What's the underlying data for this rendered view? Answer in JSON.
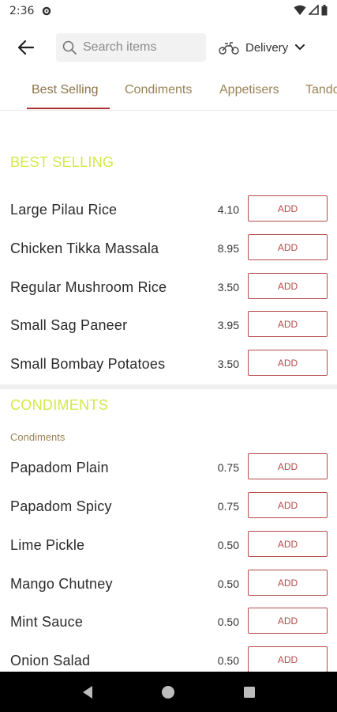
{
  "status": {
    "time": "2:36"
  },
  "search": {
    "placeholder": "Search items"
  },
  "delivery": {
    "label": "Delivery"
  },
  "tabs": [
    {
      "label": "Best Selling"
    },
    {
      "label": "Condiments"
    },
    {
      "label": "Appetisers"
    },
    {
      "label": "Tandoori"
    }
  ],
  "sections": {
    "best_selling": {
      "title": "BEST SELLING",
      "items": [
        {
          "name": "Large Pilau Rice",
          "price": "4.10",
          "button": "ADD"
        },
        {
          "name": "Chicken Tikka Massala",
          "price": "8.95",
          "button": "ADD"
        },
        {
          "name": "Regular Mushroom Rice",
          "price": "3.50",
          "button": "ADD"
        },
        {
          "name": "Small Sag Paneer",
          "price": "3.95",
          "button": "ADD"
        },
        {
          "name": "Small Bombay Potatoes",
          "price": "3.50",
          "button": "ADD"
        }
      ]
    },
    "condiments": {
      "title": "CONDIMENTS",
      "subtitle": "Condiments",
      "items": [
        {
          "name": "Papadom Plain",
          "price": "0.75",
          "button": "ADD"
        },
        {
          "name": "Papadom Spicy",
          "price": "0.75",
          "button": "ADD"
        },
        {
          "name": "Lime Pickle",
          "price": "0.50",
          "button": "ADD"
        },
        {
          "name": "Mango Chutney",
          "price": "0.50",
          "button": "ADD"
        },
        {
          "name": "Mint Sauce",
          "price": "0.50",
          "button": "ADD"
        },
        {
          "name": "Onion Salad",
          "price": "0.50",
          "button": "ADD"
        }
      ]
    }
  },
  "colors": {
    "accent": "#b54a4a",
    "section_title": "#d4e84a",
    "tab_text": "#9a8255"
  }
}
